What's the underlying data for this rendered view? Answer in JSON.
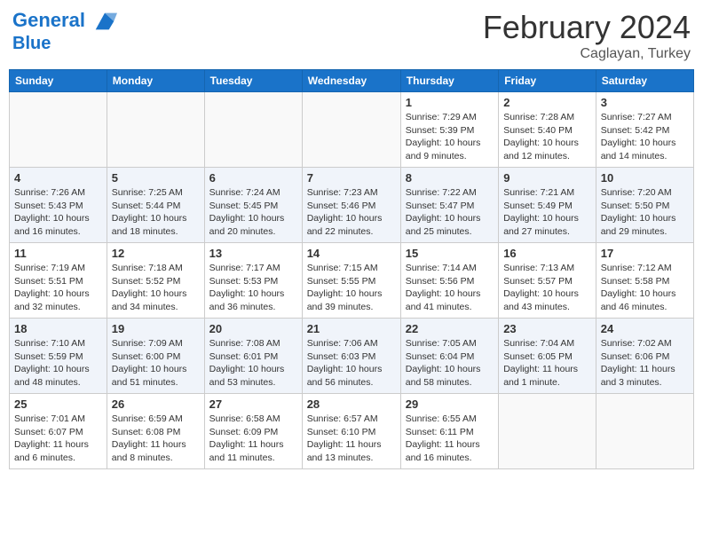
{
  "header": {
    "logo_line1": "General",
    "logo_line2": "Blue",
    "title": "February 2024",
    "subtitle": "Caglayan, Turkey"
  },
  "columns": [
    "Sunday",
    "Monday",
    "Tuesday",
    "Wednesday",
    "Thursday",
    "Friday",
    "Saturday"
  ],
  "weeks": [
    [
      {
        "day": "",
        "info": ""
      },
      {
        "day": "",
        "info": ""
      },
      {
        "day": "",
        "info": ""
      },
      {
        "day": "",
        "info": ""
      },
      {
        "day": "1",
        "info": "Sunrise: 7:29 AM\nSunset: 5:39 PM\nDaylight: 10 hours\nand 9 minutes."
      },
      {
        "day": "2",
        "info": "Sunrise: 7:28 AM\nSunset: 5:40 PM\nDaylight: 10 hours\nand 12 minutes."
      },
      {
        "day": "3",
        "info": "Sunrise: 7:27 AM\nSunset: 5:42 PM\nDaylight: 10 hours\nand 14 minutes."
      }
    ],
    [
      {
        "day": "4",
        "info": "Sunrise: 7:26 AM\nSunset: 5:43 PM\nDaylight: 10 hours\nand 16 minutes."
      },
      {
        "day": "5",
        "info": "Sunrise: 7:25 AM\nSunset: 5:44 PM\nDaylight: 10 hours\nand 18 minutes."
      },
      {
        "day": "6",
        "info": "Sunrise: 7:24 AM\nSunset: 5:45 PM\nDaylight: 10 hours\nand 20 minutes."
      },
      {
        "day": "7",
        "info": "Sunrise: 7:23 AM\nSunset: 5:46 PM\nDaylight: 10 hours\nand 22 minutes."
      },
      {
        "day": "8",
        "info": "Sunrise: 7:22 AM\nSunset: 5:47 PM\nDaylight: 10 hours\nand 25 minutes."
      },
      {
        "day": "9",
        "info": "Sunrise: 7:21 AM\nSunset: 5:49 PM\nDaylight: 10 hours\nand 27 minutes."
      },
      {
        "day": "10",
        "info": "Sunrise: 7:20 AM\nSunset: 5:50 PM\nDaylight: 10 hours\nand 29 minutes."
      }
    ],
    [
      {
        "day": "11",
        "info": "Sunrise: 7:19 AM\nSunset: 5:51 PM\nDaylight: 10 hours\nand 32 minutes."
      },
      {
        "day": "12",
        "info": "Sunrise: 7:18 AM\nSunset: 5:52 PM\nDaylight: 10 hours\nand 34 minutes."
      },
      {
        "day": "13",
        "info": "Sunrise: 7:17 AM\nSunset: 5:53 PM\nDaylight: 10 hours\nand 36 minutes."
      },
      {
        "day": "14",
        "info": "Sunrise: 7:15 AM\nSunset: 5:55 PM\nDaylight: 10 hours\nand 39 minutes."
      },
      {
        "day": "15",
        "info": "Sunrise: 7:14 AM\nSunset: 5:56 PM\nDaylight: 10 hours\nand 41 minutes."
      },
      {
        "day": "16",
        "info": "Sunrise: 7:13 AM\nSunset: 5:57 PM\nDaylight: 10 hours\nand 43 minutes."
      },
      {
        "day": "17",
        "info": "Sunrise: 7:12 AM\nSunset: 5:58 PM\nDaylight: 10 hours\nand 46 minutes."
      }
    ],
    [
      {
        "day": "18",
        "info": "Sunrise: 7:10 AM\nSunset: 5:59 PM\nDaylight: 10 hours\nand 48 minutes."
      },
      {
        "day": "19",
        "info": "Sunrise: 7:09 AM\nSunset: 6:00 PM\nDaylight: 10 hours\nand 51 minutes."
      },
      {
        "day": "20",
        "info": "Sunrise: 7:08 AM\nSunset: 6:01 PM\nDaylight: 10 hours\nand 53 minutes."
      },
      {
        "day": "21",
        "info": "Sunrise: 7:06 AM\nSunset: 6:03 PM\nDaylight: 10 hours\nand 56 minutes."
      },
      {
        "day": "22",
        "info": "Sunrise: 7:05 AM\nSunset: 6:04 PM\nDaylight: 10 hours\nand 58 minutes."
      },
      {
        "day": "23",
        "info": "Sunrise: 7:04 AM\nSunset: 6:05 PM\nDaylight: 11 hours\nand 1 minute."
      },
      {
        "day": "24",
        "info": "Sunrise: 7:02 AM\nSunset: 6:06 PM\nDaylight: 11 hours\nand 3 minutes."
      }
    ],
    [
      {
        "day": "25",
        "info": "Sunrise: 7:01 AM\nSunset: 6:07 PM\nDaylight: 11 hours\nand 6 minutes."
      },
      {
        "day": "26",
        "info": "Sunrise: 6:59 AM\nSunset: 6:08 PM\nDaylight: 11 hours\nand 8 minutes."
      },
      {
        "day": "27",
        "info": "Sunrise: 6:58 AM\nSunset: 6:09 PM\nDaylight: 11 hours\nand 11 minutes."
      },
      {
        "day": "28",
        "info": "Sunrise: 6:57 AM\nSunset: 6:10 PM\nDaylight: 11 hours\nand 13 minutes."
      },
      {
        "day": "29",
        "info": "Sunrise: 6:55 AM\nSunset: 6:11 PM\nDaylight: 11 hours\nand 16 minutes."
      },
      {
        "day": "",
        "info": ""
      },
      {
        "day": "",
        "info": ""
      }
    ]
  ]
}
